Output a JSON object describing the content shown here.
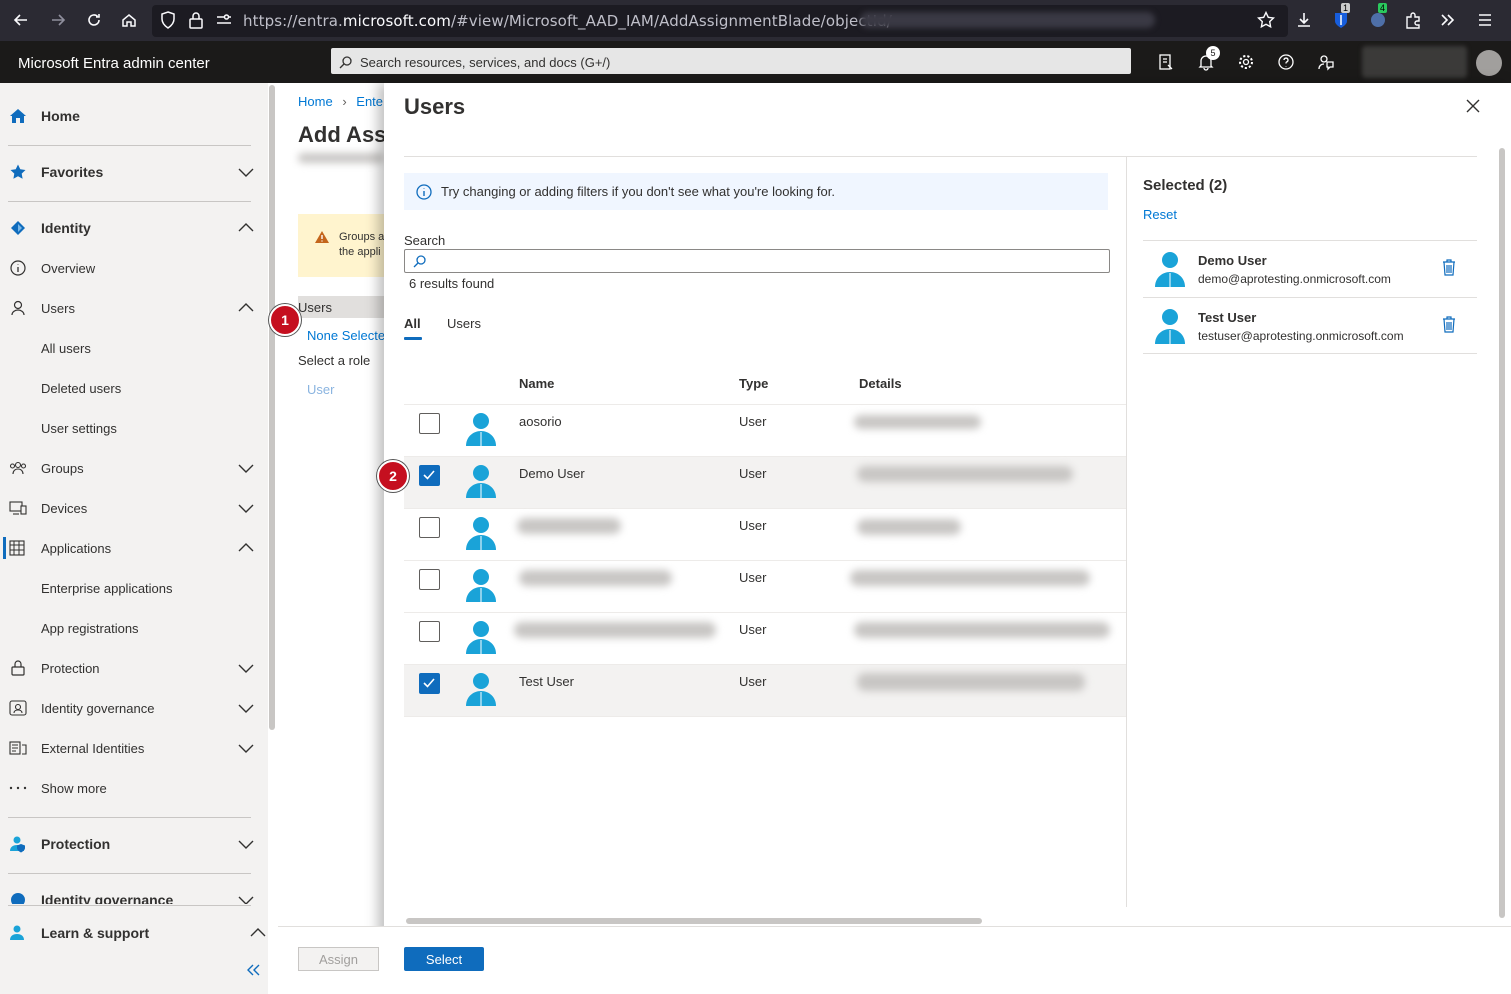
{
  "browser": {
    "url_prefix": "https://entra.",
    "url_domain": "microsoft.com",
    "url_path": "/#view/Microsoft_AAD_IAM/AddAssignmentBlade/objectId/",
    "ext_badge_1": "1",
    "ext_badge_2": "4"
  },
  "header": {
    "app_title": "Microsoft Entra admin center",
    "search_placeholder": "Search resources, services, and docs (G+/)",
    "notification_count": "5"
  },
  "nav": {
    "home": "Home",
    "favorites": "Favorites",
    "identity": "Identity",
    "overview": "Overview",
    "users": "Users",
    "all_users": "All users",
    "deleted_users": "Deleted users",
    "user_settings": "User settings",
    "groups": "Groups",
    "devices": "Devices",
    "applications": "Applications",
    "enterprise_apps": "Enterprise applications",
    "app_registrations": "App registrations",
    "protection": "Protection",
    "identity_governance": "Identity governance",
    "external_identities": "External Identities",
    "show_more": "Show more",
    "protection_section": "Protection",
    "identity_governance_section": "Identity governance",
    "learn_support": "Learn & support"
  },
  "behind": {
    "crumb_home": "Home",
    "crumb_next": "Ente",
    "title": "Add Ass",
    "warn_line1": "Groups a",
    "warn_line2": "the appli",
    "users_label": "Users",
    "none_selected": "None Selecte",
    "select_role": "Select a role",
    "role_value": "User",
    "assign_button": "Assign"
  },
  "panel": {
    "title": "Users",
    "info_text": "Try changing or adding filters if you don't see what you're looking for.",
    "search_label": "Search",
    "results_count": "6 results found",
    "tabs": [
      "All",
      "Users"
    ],
    "columns": [
      "Name",
      "Type",
      "Details"
    ],
    "rows": [
      {
        "name": "aosorio",
        "type": "User",
        "checked": false
      },
      {
        "name": "Demo User",
        "type": "User",
        "checked": true
      },
      {
        "name": "",
        "type": "User",
        "checked": false
      },
      {
        "name": "",
        "type": "User",
        "checked": false
      },
      {
        "name": "",
        "type": "User",
        "checked": false
      },
      {
        "name": "Test User",
        "type": "User",
        "checked": true
      }
    ],
    "select_button": "Select"
  },
  "selected": {
    "title": "Selected (2)",
    "reset": "Reset",
    "items": [
      {
        "name": "Demo User",
        "email": "demo@aprotesting.onmicrosoft.com"
      },
      {
        "name": "Test User",
        "email": "testuser@aprotesting.onmicrosoft.com"
      }
    ]
  },
  "annotations": {
    "step1": "1",
    "step2": "2"
  },
  "colors": {
    "accent": "#0f6cbd",
    "user_icon": "#1aa3d8",
    "badge": "#c50f1f"
  },
  "icons": [
    "back-icon",
    "forward-icon",
    "reload-icon",
    "home-icon",
    "shield-icon",
    "lock-icon",
    "bookmark-star-icon",
    "download-icon",
    "extension-icon",
    "menu-icon",
    "search-icon",
    "directory-icon",
    "bell-icon",
    "gear-icon",
    "help-icon",
    "feedback-icon",
    "info-icon",
    "warning-icon",
    "user-icon",
    "trash-icon",
    "close-icon",
    "chevron-down-icon",
    "chevron-up-icon",
    "collapse-icon"
  ]
}
